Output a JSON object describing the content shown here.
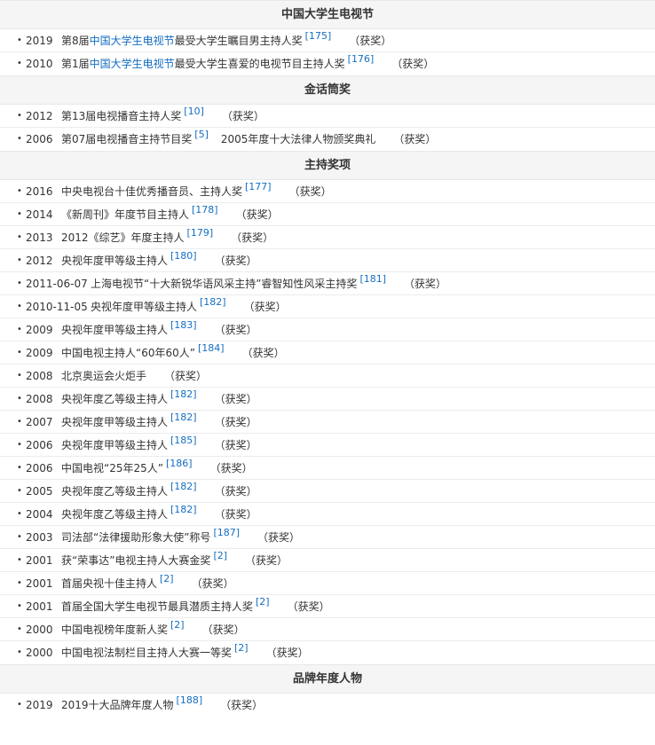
{
  "sections": [
    {
      "title": "中国大学生电视节",
      "rows": [
        {
          "year": "2019",
          "pre": "第8届",
          "hl": "中国大学生电视节",
          "post": "最受大学生瞩目男主持人奖",
          "ref": "[175]",
          "extra": "",
          "status": "（获奖）"
        },
        {
          "year": "2010",
          "pre": "第1届",
          "hl": "中国大学生电视节",
          "post": "最受大学生喜爱的电视节目主持人奖",
          "ref": "[176]",
          "extra": "",
          "status": "（获奖）"
        }
      ]
    },
    {
      "title": "金话筒奖",
      "rows": [
        {
          "year": "2012",
          "pre": "第13届电视播音主持人奖",
          "hl": "",
          "post": "",
          "ref": "[10]",
          "extra": "",
          "status": "（获奖）"
        },
        {
          "year": "2006",
          "pre": "第07届电视播音主持节目奖",
          "hl": "",
          "post": "",
          "ref": "[5]",
          "extra": "2005年度十大法律人物颁奖典礼",
          "status": "（获奖）"
        }
      ]
    },
    {
      "title": "主持奖项",
      "rows": [
        {
          "year": "2016",
          "pre": "中央电视台十佳优秀播音员、主持人奖",
          "hl": "",
          "post": "",
          "ref": "[177]",
          "extra": "",
          "status": "（获奖）"
        },
        {
          "year": "2014",
          "pre": "《新周刊》年度节目主持人",
          "hl": "",
          "post": "",
          "ref": "[178]",
          "extra": "",
          "status": "（获奖）"
        },
        {
          "year": "2013",
          "pre": "2012《综艺》年度主持人",
          "hl": "",
          "post": "",
          "ref": "[179]",
          "extra": "",
          "status": "（获奖）"
        },
        {
          "year": "2012",
          "pre": "央视年度甲等级主持人",
          "hl": "",
          "post": "",
          "ref": "[180]",
          "extra": "",
          "status": "（获奖）"
        },
        {
          "year": "2011-06-07",
          "wide": true,
          "pre": "上海电视节“十大新锐华语风采主持”睿智知性风采主持奖",
          "hl": "",
          "post": "",
          "ref": "[181]",
          "extra": "",
          "status": "（获奖）"
        },
        {
          "year": "2010-11-05",
          "wide": true,
          "pre": "央视年度甲等级主持人",
          "hl": "",
          "post": "",
          "ref": "[182]",
          "extra": "",
          "status": "（获奖）"
        },
        {
          "year": "2009",
          "pre": "央视年度甲等级主持人",
          "hl": "",
          "post": "",
          "ref": "[183]",
          "extra": "",
          "status": "（获奖）"
        },
        {
          "year": "2009",
          "pre": "中国电视主持人“60年60人”",
          "hl": "",
          "post": "",
          "ref": "[184]",
          "extra": "",
          "status": "（获奖）"
        },
        {
          "year": "2008",
          "pre": "北京奥运会火炬手",
          "hl": "",
          "post": "",
          "ref": "",
          "extra": "",
          "status": "（获奖）"
        },
        {
          "year": "2008",
          "pre": "央视年度乙等级主持人",
          "hl": "",
          "post": "",
          "ref": "[182]",
          "extra": "",
          "status": "（获奖）"
        },
        {
          "year": "2007",
          "pre": "央视年度甲等级主持人",
          "hl": "",
          "post": "",
          "ref": "[182]",
          "extra": "",
          "status": "（获奖）"
        },
        {
          "year": "2006",
          "pre": "央视年度甲等级主持人",
          "hl": "",
          "post": "",
          "ref": "[185]",
          "extra": "",
          "status": "（获奖）"
        },
        {
          "year": "2006",
          "pre": "中国电视“25年25人”",
          "hl": "",
          "post": "",
          "ref": "[186]",
          "extra": "",
          "status": "（获奖）"
        },
        {
          "year": "2005",
          "pre": "央视年度乙等级主持人",
          "hl": "",
          "post": "",
          "ref": "[182]",
          "extra": "",
          "status": "（获奖）"
        },
        {
          "year": "2004",
          "pre": "央视年度乙等级主持人",
          "hl": "",
          "post": "",
          "ref": "[182]",
          "extra": "",
          "status": "（获奖）"
        },
        {
          "year": "2003",
          "pre": "司法部“法律援助形象大使”称号",
          "hl": "",
          "post": "",
          "ref": "[187]",
          "extra": "",
          "status": "（获奖）"
        },
        {
          "year": "2001",
          "pre": "获“荣事达”电视主持人大赛金奖",
          "hl": "",
          "post": "",
          "ref": "[2]",
          "extra": "",
          "status": "（获奖）"
        },
        {
          "year": "2001",
          "pre": "首届央视十佳主持人",
          "hl": "",
          "post": "",
          "ref": "[2]",
          "extra": "",
          "status": "（获奖）"
        },
        {
          "year": "2001",
          "pre": "首届全国大学生电视节最具潜质主持人奖",
          "hl": "",
          "post": "",
          "ref": "[2]",
          "extra": "",
          "status": "（获奖）"
        },
        {
          "year": "2000",
          "pre": "中国电视榜年度新人奖",
          "hl": "",
          "post": "",
          "ref": "[2]",
          "extra": "",
          "status": "（获奖）"
        },
        {
          "year": "2000",
          "pre": "中国电视法制栏目主持人大赛一等奖",
          "hl": "",
          "post": "",
          "ref": "[2]",
          "extra": "",
          "status": "（获奖）"
        }
      ]
    },
    {
      "title": "品牌年度人物",
      "rows": [
        {
          "year": "2019",
          "pre": "2019十大品牌年度人物",
          "hl": "",
          "post": "",
          "ref": "[188]",
          "extra": "",
          "status": "（获奖）"
        }
      ]
    }
  ]
}
